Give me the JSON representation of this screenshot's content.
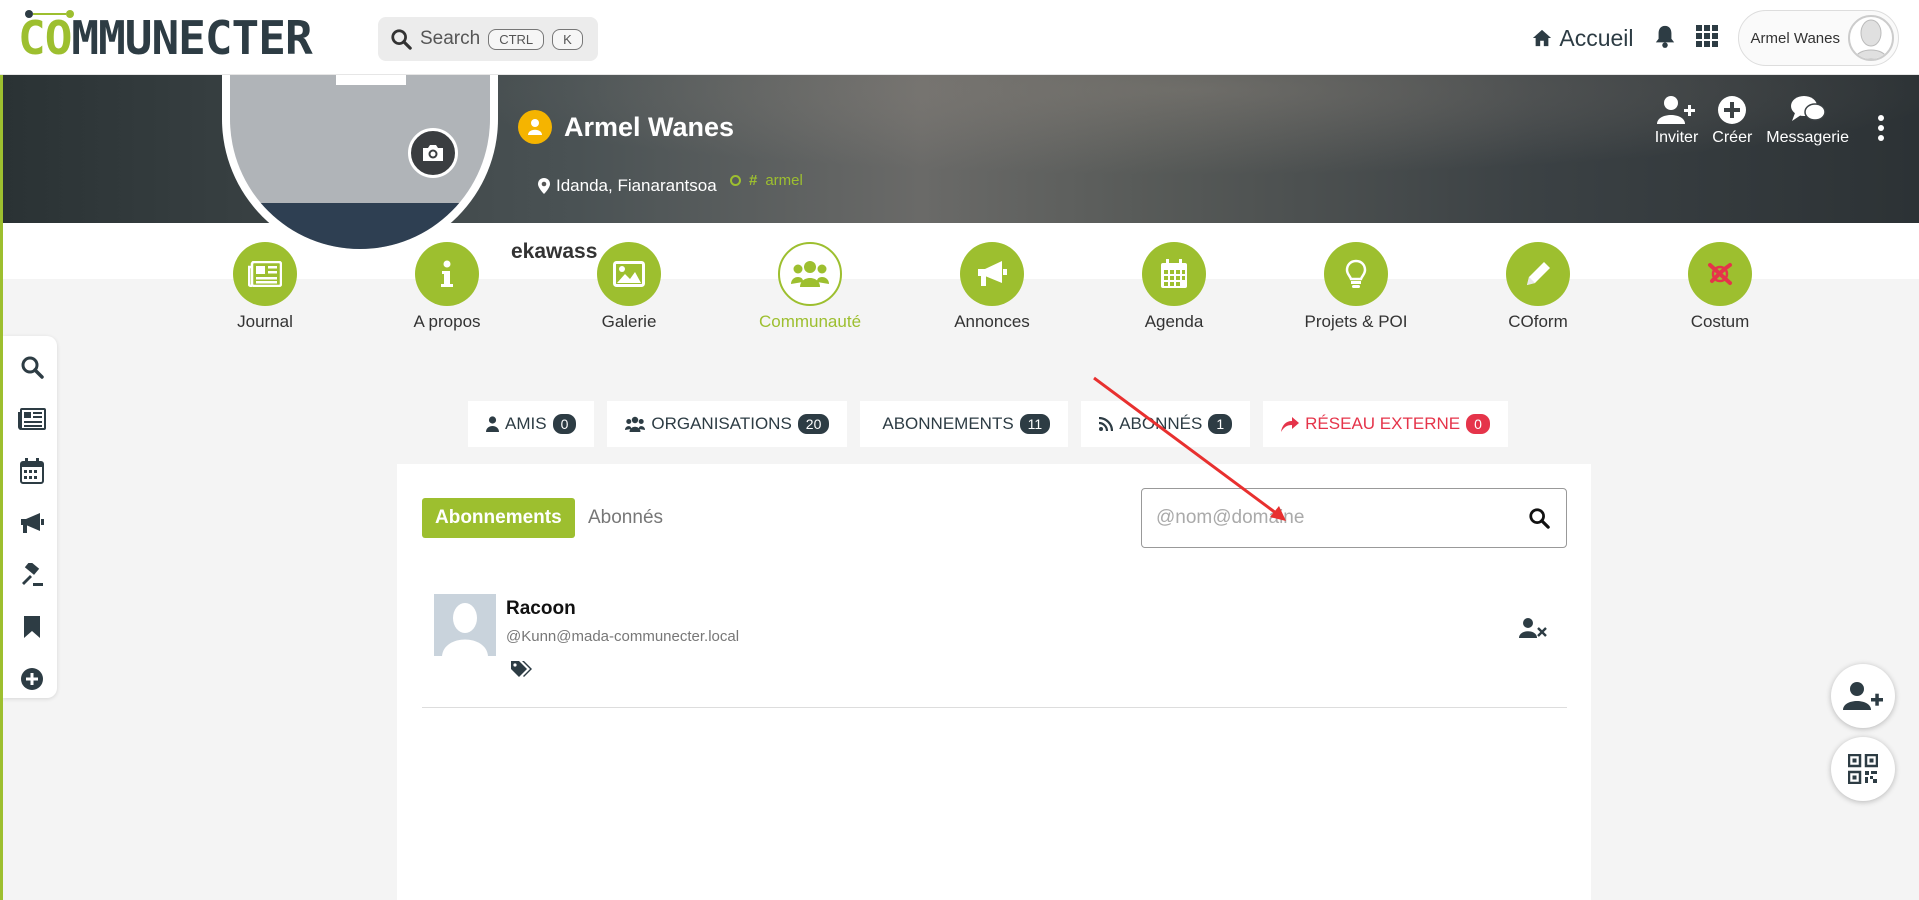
{
  "app": {
    "logo_prefix": "CO",
    "logo_rest": "MMUNECTER",
    "brand_color": "#9dbf2f",
    "dark_color": "#2d3c44",
    "alert_color": "#e5344a"
  },
  "topbar": {
    "search_label": "Search",
    "kbd_ctrl": "CTRL",
    "kbd_k": "K",
    "home_label": "Accueil",
    "user_name": "Armel Wanes",
    "icons": [
      "search-icon",
      "home-icon",
      "bell-icon",
      "apps-grid-icon",
      "avatar"
    ]
  },
  "profile": {
    "name": "Armel Wanes",
    "location": "Idanda, Fianarantsoa",
    "tag": "armel",
    "overflow_text": "ekawass"
  },
  "banner_actions": [
    {
      "label": "Inviter",
      "icon": "user-plus-icon"
    },
    {
      "label": "Créer",
      "icon": "plus-circle-icon"
    },
    {
      "label": "Messagerie",
      "icon": "chat-icon"
    }
  ],
  "nav": {
    "items": [
      {
        "label": "Journal",
        "icon": "newspaper-icon"
      },
      {
        "label": "A propos",
        "icon": "info-icon"
      },
      {
        "label": "Galerie",
        "icon": "image-icon"
      },
      {
        "label": "Communauté",
        "icon": "users-icon",
        "active": true
      },
      {
        "label": "Annonces",
        "icon": "megaphone-icon"
      },
      {
        "label": "Agenda",
        "icon": "calendar-icon"
      },
      {
        "label": "Projets & POI",
        "icon": "lightbulb-icon"
      },
      {
        "label": "COform",
        "icon": "pencil-icon"
      },
      {
        "label": "Costum",
        "icon": "costum-icon"
      }
    ]
  },
  "sidebar": {
    "icons": [
      "search-icon",
      "newspaper-icon",
      "calendar-icon",
      "megaphone-icon",
      "gavel-icon",
      "bookmark-icon",
      "plus-circle-icon"
    ]
  },
  "filters": [
    {
      "label": "AMIS",
      "count": "0",
      "icon": "user-icon"
    },
    {
      "label": "ORGANISATIONS",
      "count": "20",
      "icon": "users-icon"
    },
    {
      "label": "ABONNEMENTS",
      "count": "11",
      "icon": ""
    },
    {
      "label": "ABONNÉS",
      "count": "1",
      "icon": "rss-icon"
    },
    {
      "label": "RÉSEAU EXTERNE",
      "count": "0",
      "icon": "share-icon"
    }
  ],
  "panel": {
    "tab_active": "Abonnements",
    "tab_inactive": "Abonnés",
    "search_placeholder": "@nom@domaine",
    "search_value": "",
    "rows": [
      {
        "name": "Racoon",
        "handle": "@Kunn@mada-communecter.local"
      }
    ]
  },
  "fabs": [
    "add-user-icon",
    "qr-code-icon"
  ]
}
